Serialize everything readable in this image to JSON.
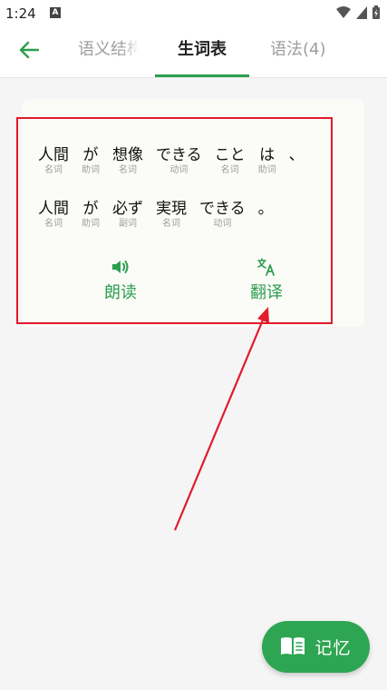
{
  "status_bar": {
    "time": "1:24",
    "app_icon_letter": "A"
  },
  "header": {
    "tabs": [
      {
        "label": "语义结构",
        "active": false
      },
      {
        "label": "生词表",
        "active": true
      },
      {
        "label": "语法(4)",
        "active": false
      }
    ]
  },
  "card": {
    "sentences": [
      [
        {
          "text": "人間",
          "pos": "名词"
        },
        {
          "text": "が",
          "pos": "助词"
        },
        {
          "text": "想像",
          "pos": "名词"
        },
        {
          "text": "できる",
          "pos": "动词"
        },
        {
          "text": "こと",
          "pos": "名词"
        },
        {
          "text": "は",
          "pos": "助词"
        },
        {
          "text": "、",
          "pos": ""
        }
      ],
      [
        {
          "text": "人間",
          "pos": "名词"
        },
        {
          "text": "が",
          "pos": "助词"
        },
        {
          "text": "必ず",
          "pos": "副词"
        },
        {
          "text": "実現",
          "pos": "名词"
        },
        {
          "text": "できる",
          "pos": "动词"
        },
        {
          "text": "。",
          "pos": ""
        }
      ]
    ],
    "actions": {
      "read_label": "朗读",
      "translate_label": "翻译"
    }
  },
  "fab": {
    "label": "记忆"
  },
  "colors": {
    "accent": "#2e9e4f",
    "annotation": "#e21a2b"
  }
}
